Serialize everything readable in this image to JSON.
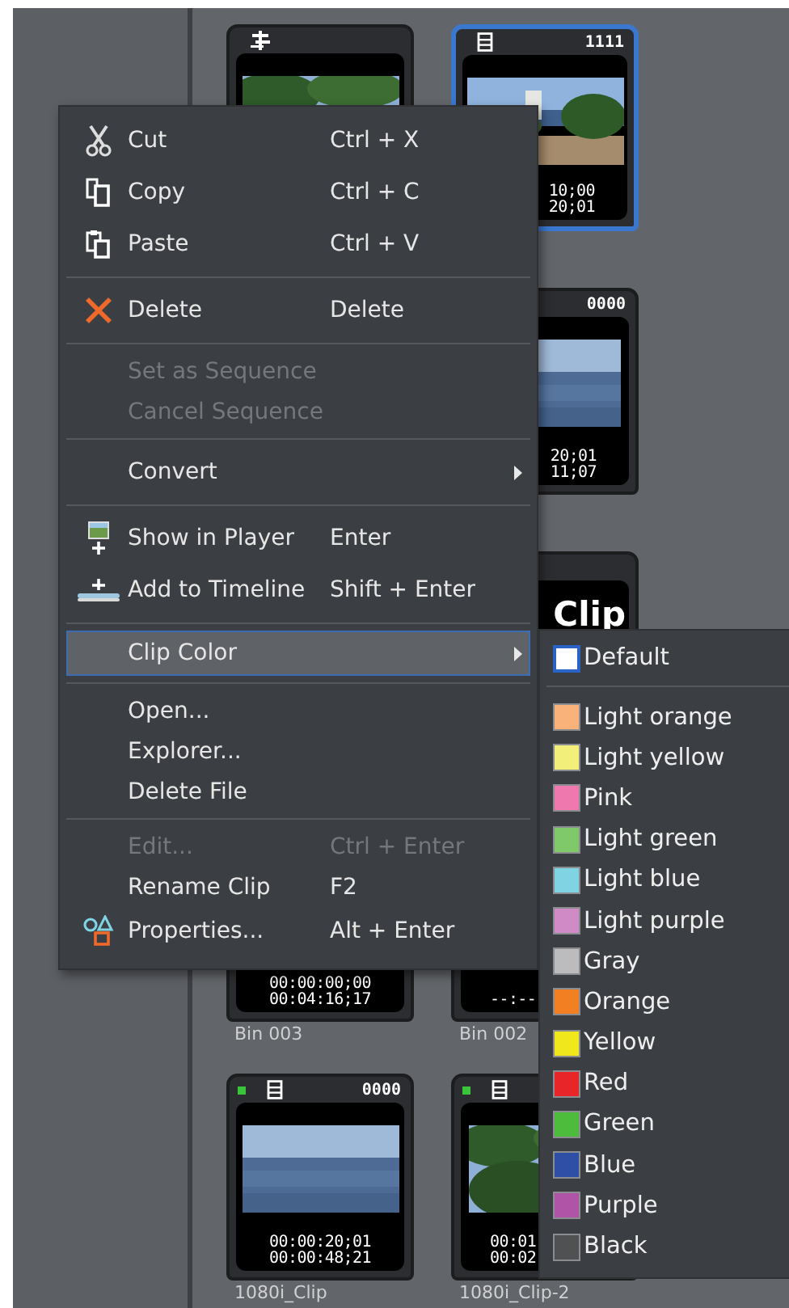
{
  "clips": [
    {
      "selected": false,
      "online": false
    },
    {
      "selected": true,
      "online": false,
      "number": "1111",
      "timecodes": [
        "10;00",
        "20;01"
      ]
    },
    {
      "selected": false,
      "online": false,
      "number": "0000",
      "timecodes": [
        "20;01",
        "11;07"
      ]
    },
    {
      "selected": false,
      "online": false,
      "title": "Clip"
    },
    {
      "selected": false,
      "online": false,
      "timecodes": [
        "00:00:00;00",
        "00:04:16;17"
      ],
      "label": "Bin 003"
    },
    {
      "selected": false,
      "online": false,
      "timecodes": [
        "--:--"
      ],
      "label": "Bin 002"
    },
    {
      "selected": false,
      "online": true,
      "number": "0000",
      "timecodes": [
        "00:00:20;01",
        "00:00:48;21"
      ],
      "label": "1080i_Clip"
    },
    {
      "selected": false,
      "online": true,
      "timecodes": [
        "00:01",
        "00:02"
      ],
      "label": "1080i_Clip-2"
    }
  ],
  "context_menu": {
    "groups": [
      [
        {
          "label": "Cut",
          "shortcut": "Ctrl + X",
          "disabled": false,
          "submenu": false,
          "selected": false
        },
        {
          "label": "Copy",
          "shortcut": "Ctrl + C",
          "disabled": false,
          "submenu": false,
          "selected": false
        },
        {
          "label": "Paste",
          "shortcut": "Ctrl + V",
          "disabled": false,
          "submenu": false,
          "selected": false
        }
      ],
      [
        {
          "label": "Delete",
          "shortcut": "Delete",
          "disabled": false,
          "submenu": false,
          "selected": false
        }
      ],
      [
        {
          "label": "Set as Sequence",
          "disabled": true,
          "submenu": false,
          "selected": false
        },
        {
          "label": "Cancel Sequence",
          "disabled": true,
          "submenu": false,
          "selected": false
        }
      ],
      [
        {
          "label": "Convert",
          "disabled": false,
          "submenu": true,
          "selected": false
        }
      ],
      [
        {
          "label": "Show in Player",
          "shortcut": "Enter",
          "disabled": false,
          "submenu": false,
          "selected": false
        },
        {
          "label": "Add to Timeline",
          "shortcut": "Shift + Enter",
          "disabled": false,
          "submenu": false,
          "selected": false
        }
      ],
      [
        {
          "label": "Clip Color",
          "disabled": false,
          "submenu": true,
          "selected": true
        }
      ],
      [
        {
          "label": "Open...",
          "disabled": false,
          "submenu": false,
          "selected": false
        },
        {
          "label": "Explorer...",
          "disabled": false,
          "submenu": false,
          "selected": false
        },
        {
          "label": "Delete File",
          "disabled": false,
          "submenu": false,
          "selected": false
        }
      ],
      [
        {
          "label": "Edit...",
          "shortcut": "Ctrl + Enter",
          "disabled": true,
          "submenu": false,
          "selected": false
        },
        {
          "label": "Rename Clip",
          "shortcut": "F2",
          "disabled": false,
          "submenu": false,
          "selected": false
        },
        {
          "label": "Properties...",
          "shortcut": "Alt + Enter",
          "disabled": false,
          "submenu": false,
          "selected": false
        }
      ]
    ]
  },
  "clip_color_menu": {
    "groups": [
      [
        {
          "label": "Default",
          "color": "#ffffff",
          "selected": true
        }
      ],
      [
        {
          "label": "Light orange",
          "color": "#f9b27a",
          "selected": false
        },
        {
          "label": "Light yellow",
          "color": "#f2ef7a",
          "selected": false
        },
        {
          "label": "Pink",
          "color": "#ef79ae",
          "selected": false
        },
        {
          "label": "Light green",
          "color": "#7fc96a",
          "selected": false
        },
        {
          "label": "Light blue",
          "color": "#7fd3e3",
          "selected": false
        },
        {
          "label": "Light purple",
          "color": "#d08ac6",
          "selected": false
        },
        {
          "label": "Gray",
          "color": "#bcbcbe",
          "selected": false
        },
        {
          "label": "Orange",
          "color": "#f27f22",
          "selected": false
        },
        {
          "label": "Yellow",
          "color": "#f0e81c",
          "selected": false
        },
        {
          "label": "Red",
          "color": "#e8262a",
          "selected": false
        },
        {
          "label": "Green",
          "color": "#4dbb3c",
          "selected": false
        },
        {
          "label": "Blue",
          "color": "#2f4ea6",
          "selected": false
        },
        {
          "label": "Purple",
          "color": "#b054a8",
          "selected": false
        },
        {
          "label": "Black",
          "color": "#505153",
          "selected": false
        }
      ]
    ]
  }
}
